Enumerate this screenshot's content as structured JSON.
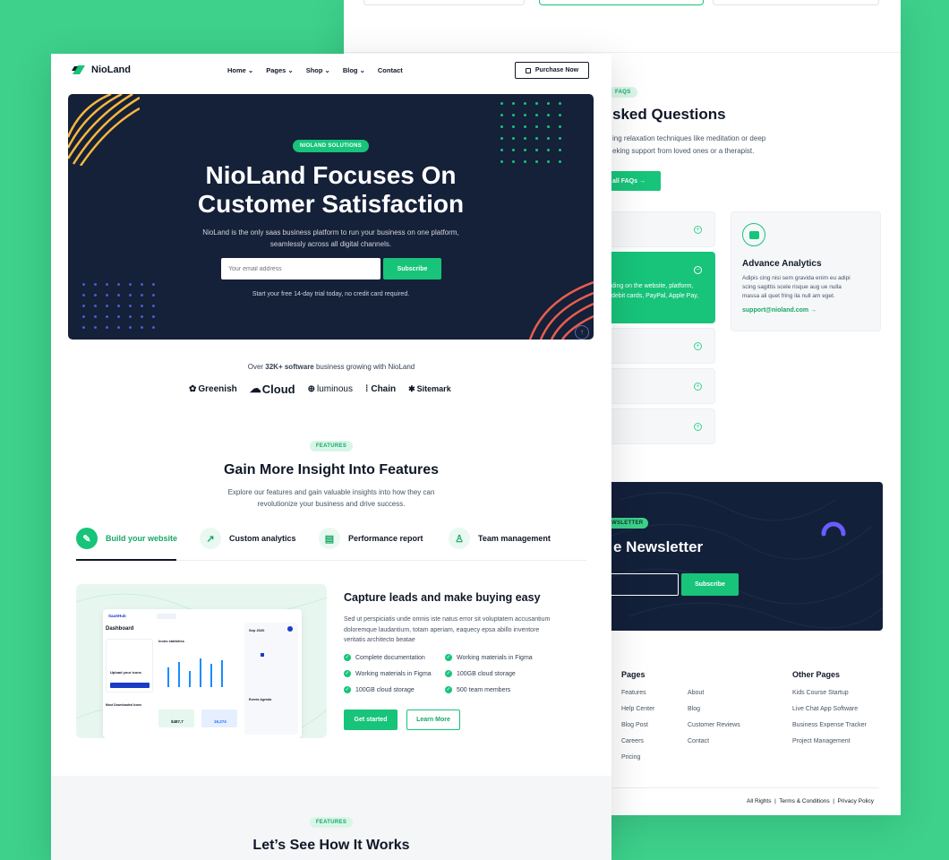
{
  "back": {
    "faq": {
      "tag": "FAQS",
      "title": "sked Questions",
      "desc1": "ing relaxation techniques like meditation or deep",
      "desc2": "eking support from loved ones or a therapist.",
      "button": "all FAQs",
      "open_line1": "ding on the website, platform,",
      "open_line2": "debit cards, PayPal, Apple Pay,"
    },
    "card": {
      "title": "Advance Analytics",
      "text1": "Adipis cing nisi sem gravida enim eu adipi",
      "text2": "scing sagittis scele risque aug ue nulla",
      "text3": "massa ali quet fring ila null am eget.",
      "link": "support@nioland.com"
    },
    "newsletter": {
      "tag": "WSLETTER",
      "title": "e Newsletter",
      "button": "Subscribe"
    },
    "footer": {
      "col1_title": "Pages",
      "col1a": [
        "Features",
        "Help Center",
        "Blog Post",
        "Careers",
        "Pricing"
      ],
      "col1b": [
        "About",
        "Blog",
        "Customer Reviews",
        "Contact"
      ],
      "col2_title": "Other Pages",
      "col2": [
        "Kids Course Startup",
        "Live Chat App Software",
        "Business Expense Tracker",
        "Project Management"
      ],
      "legal": [
        "All Rights",
        "Terms & Conditions",
        "Privacy Policy"
      ]
    }
  },
  "front": {
    "brand": "NioLand",
    "nav": [
      "Home",
      "Pages",
      "Shop",
      "Blog",
      "Contact"
    ],
    "purchase": "Purchase Now",
    "hero": {
      "tag": "NIOLAND SOLUTIONS",
      "title1": "NioLand Focuses On",
      "title2": "Customer Satisfaction",
      "sub1": "NioLand is the only saas business platform to run your business on one platform,",
      "sub2": "seamlessly across all digital channels.",
      "email_placeholder": "Your email address",
      "subscribe": "Subscribe",
      "note": "Start your free 14-day trial today, no credit card required."
    },
    "trust": {
      "pre": "Over ",
      "bold": "32K+ software",
      "post": " business growing with NioLand",
      "logos": [
        "Greenish",
        "Cloud",
        "luminous",
        "Chain",
        "Sitemark"
      ]
    },
    "features": {
      "tag": "FEATURES",
      "title": "Gain More Insight Into Features",
      "sub1": "Explore our features and gain valuable insights into how they can",
      "sub2": "revolutionize your business and drive success.",
      "tabs": [
        "Build your website",
        "Custom analytics",
        "Performance report",
        "Team management"
      ]
    },
    "capture": {
      "title": "Capture leads and make buying easy",
      "p1": "Sed ut perspiciatis unde omnis iste natus error sit voluptatem accusantium",
      "p2": "doloremque laudantium, totam aperiam, eaquecy epsa abillo inventore",
      "p3": "veritatis architecto beatae",
      "checks_left": [
        "Complete documentation",
        "Working materials in Figma",
        "100GB cloud storage"
      ],
      "checks_right": [
        "Working materials in Figma",
        "100GB cloud storage",
        "500 team members"
      ],
      "get_started": "Get started",
      "learn_more": "Learn More"
    },
    "mock": {
      "brand": "SaaSHub",
      "page": "Dashboard",
      "upload": "Upload your icons",
      "stats": "Icons statistics",
      "cal": "Sep 2020",
      "events": "Events Agenda",
      "recent": "Most Downloaded Icons",
      "v1": "$487,7",
      "v2": "16,274"
    },
    "how": {
      "tag": "FEATURES",
      "title": "Let’s See How It Works"
    }
  },
  "colors": {
    "green": "#3dd18c",
    "accent": "#17c47a",
    "navy": "#152039"
  }
}
